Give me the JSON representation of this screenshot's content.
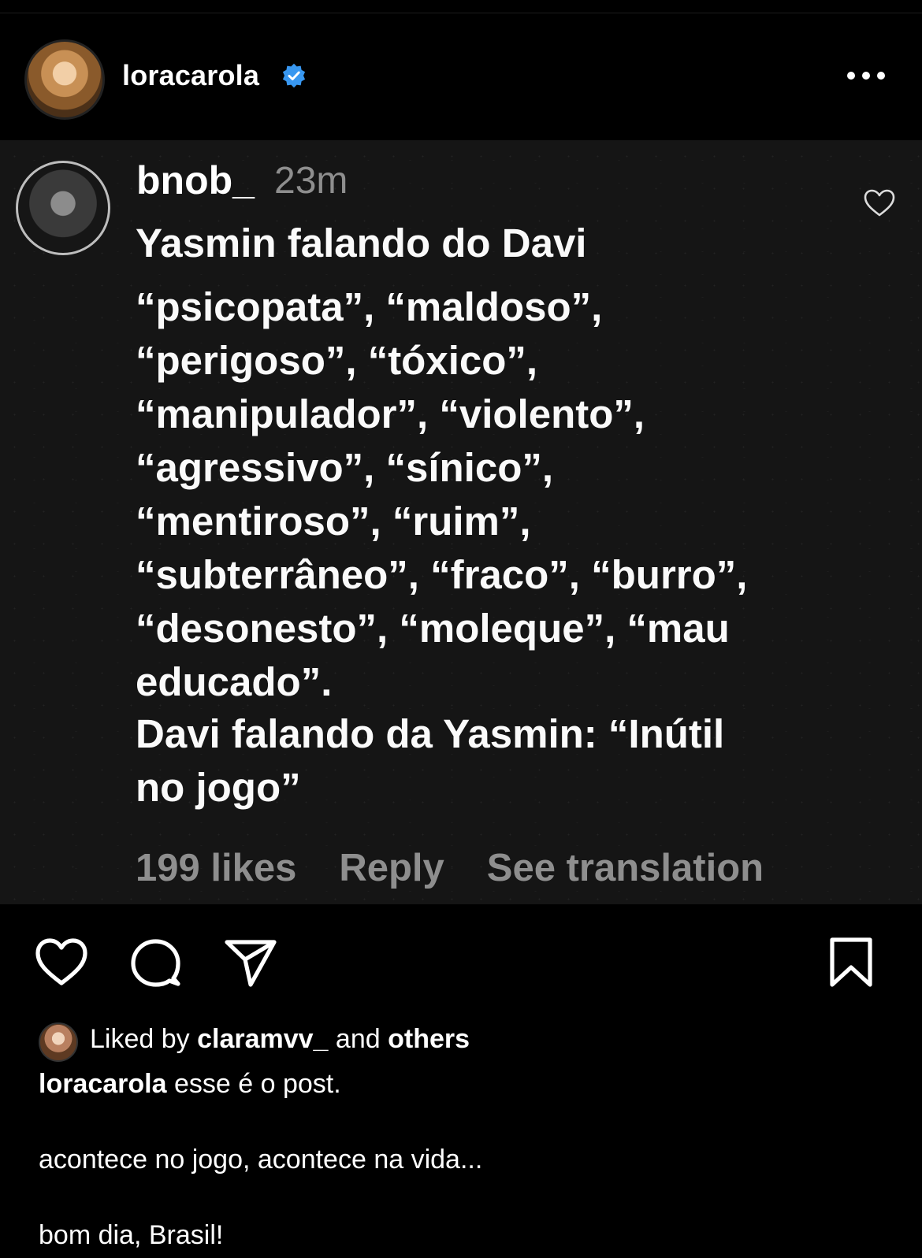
{
  "post": {
    "username": "loracarola",
    "verified": true,
    "more_icon": "more-horizontal-icon"
  },
  "comment": {
    "username": "bnob_",
    "time": "23m",
    "line1": "Yasmin falando do Davi",
    "list_text": "“psicopata”, “maldoso”,\n“perigoso”, “tóxico”,\n“manipulador”, “violento”,\n“agressivo”, “sínico”,\n“mentiroso”, “ruim”,\n“subterrâneo”, “fraco”, “burro”,\n“desonesto”, “moleque”, “mau\neducado”.",
    "line3": "Davi falando da Yasmin: “Inútil\nno jogo”",
    "likes": "199 likes",
    "reply": "Reply",
    "see_translation": "See translation"
  },
  "actions": {
    "like_icon": "heart-icon",
    "comment_icon": "comment-icon",
    "share_icon": "send-icon",
    "save_icon": "bookmark-icon"
  },
  "liked_by": {
    "prefix": "Liked by",
    "user": "claramvv_",
    "middle": "and",
    "others": "others"
  },
  "caption": {
    "username": "loracarola",
    "text": " esse é o post.\n\nacontece no jogo, acontece na vida...\n\nbom dia, Brasil!"
  },
  "colors": {
    "background": "#000000",
    "media_background": "#151515",
    "muted_text": "#8e8e8e",
    "verified_blue": "#3897f0"
  }
}
